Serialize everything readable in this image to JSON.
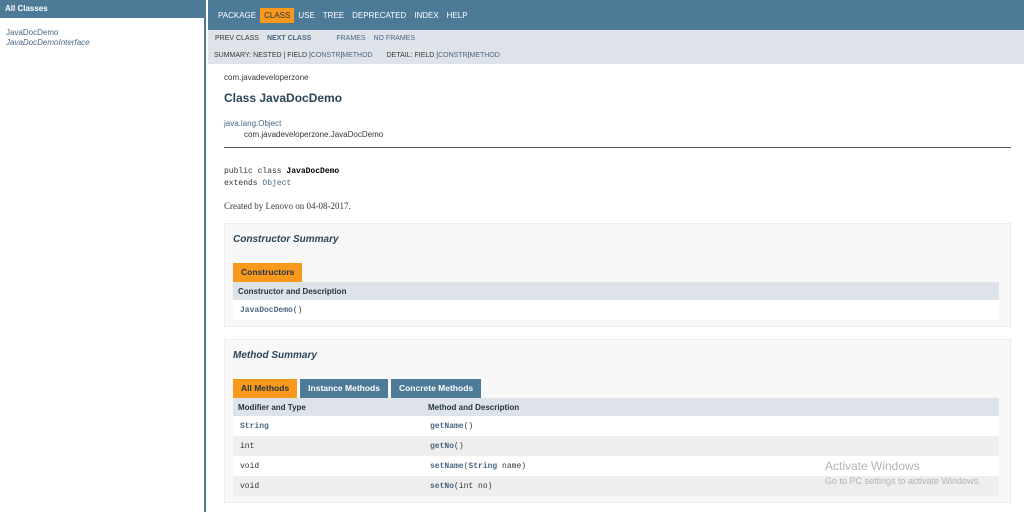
{
  "left": {
    "header": "All Classes",
    "items": [
      "JavaDocDemo",
      "JavaDocDemoInterface"
    ]
  },
  "topnav": {
    "items": [
      "PACKAGE",
      "CLASS",
      "USE",
      "TREE",
      "DEPRECATED",
      "INDEX",
      "HELP"
    ],
    "active": "CLASS"
  },
  "subnav": {
    "prev_class": "PREV CLASS",
    "next_class": "NEXT CLASS",
    "frames": "FRAMES",
    "no_frames": "NO FRAMES",
    "summary_prefix": "SUMMARY: NESTED | FIELD | ",
    "summary_constr": "CONSTR",
    "summary_sep": " | ",
    "summary_method": "METHOD",
    "detail_prefix": "DETAIL: FIELD | ",
    "detail_constr": "CONSTR",
    "detail_sep": " | ",
    "detail_method": "METHOD"
  },
  "page": {
    "package": "com.javadeveloperzone",
    "title": "Class JavaDocDemo",
    "inherit_parent": "java.lang.Object",
    "inherit_child": "com.javadeveloperzone.JavaDocDemo",
    "sig_line1_prefix": "public class ",
    "sig_class_name": "JavaDocDemo",
    "sig_line2_prefix": "extends ",
    "sig_extends": "Object",
    "description": "Created by Lenovo on 04-08-2017."
  },
  "constructor_summary": {
    "heading": "Constructor Summary",
    "tab": "Constructors",
    "column": "Constructor and Description",
    "rows": [
      {
        "name": "JavaDocDemo",
        "params": "()"
      }
    ]
  },
  "method_summary": {
    "heading": "Method Summary",
    "tabs": [
      "All Methods",
      "Instance Methods",
      "Concrete Methods"
    ],
    "columns": [
      "Modifier and Type",
      "Method and Description"
    ],
    "rows": [
      {
        "type": "String",
        "type_link": true,
        "name": "getName",
        "params": "()"
      },
      {
        "type": "int",
        "type_link": false,
        "name": "getNo",
        "params": "()"
      },
      {
        "type": "void",
        "type_link": false,
        "name": "setName",
        "params_pre": "(",
        "params_link": "String",
        "params": " name)"
      },
      {
        "type": "void",
        "type_link": false,
        "name": "setNo",
        "params": "(int no)"
      }
    ]
  },
  "watermark": {
    "line1": "Activate Windows",
    "line2": "Go to PC settings to activate Windows."
  }
}
